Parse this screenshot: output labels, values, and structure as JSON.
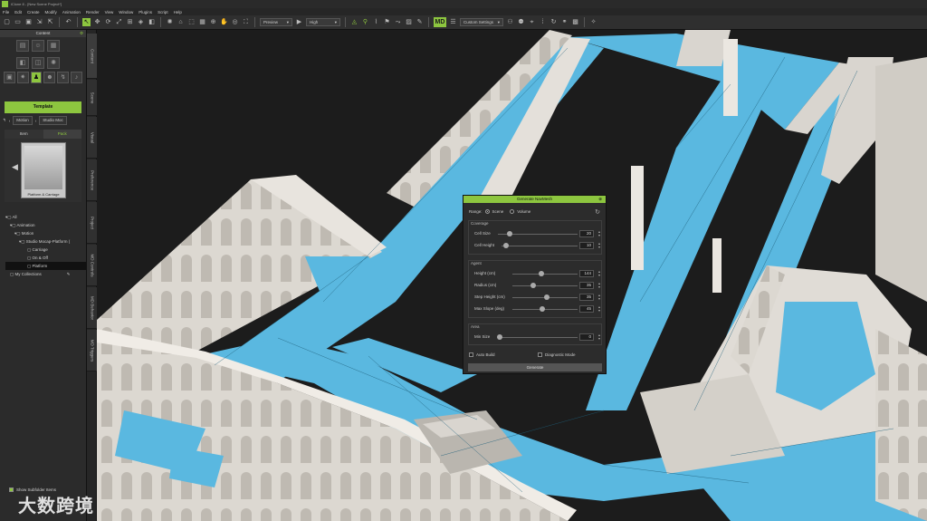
{
  "app": {
    "title": "iClone 8 - [New Scene Project*]"
  },
  "menu": [
    "File",
    "Edit",
    "Create",
    "Modify",
    "Animation",
    "Render",
    "View",
    "Window",
    "Plugins",
    "Script",
    "Help"
  ],
  "toolbar": {
    "preview_mode": "Preview",
    "quality": "High",
    "settings": "Custom Settings"
  },
  "left_panel": {
    "title": "Content",
    "template_label": "Template",
    "breadcrumb": [
      "Motion",
      "Studio Moc"
    ],
    "tabs": [
      {
        "label": "Item"
      },
      {
        "label": "Pack"
      }
    ],
    "thumbnail_caption": "Platform & Carriage",
    "tree": [
      "All",
      "Animation",
      "Motion",
      "Studio Mocap-Platform (",
      "Carriage",
      "On & Off",
      "Platform",
      "My Collections"
    ],
    "show_subfolder": "Show Subfolder Items"
  },
  "vertical_tabs": [
    "Content",
    "Scene",
    "Visual",
    "Preference",
    "Project",
    "MD Controls",
    "MD Behavior",
    "MD Triggers"
  ],
  "dialog": {
    "title": "Generate NavMesh",
    "range_label": "Range:",
    "range_scene": "Scene",
    "range_volume": "Volume",
    "coverage_label": "Coverage",
    "cell_size_label": "Cell Size",
    "cell_size": "20",
    "cell_height_label": "Cell Height",
    "cell_height": "10",
    "agent_label": "Agent",
    "height_label": "Height (cm)",
    "height": "144",
    "radius_label": "Radius (cm)",
    "radius": "35",
    "step_label": "Step Height (cm)",
    "step": "35",
    "slope_label": "Max Slope (deg)",
    "slope": "45",
    "area_label": "Area",
    "min_size_label": "Min Size",
    "min_size": "0",
    "auto_build": "Auto Build",
    "diagnostic": "Diagnostic Mode",
    "generate": "Generate"
  },
  "watermark": "大数跨境",
  "colors": {
    "accent": "#8dc63f",
    "navmesh": "#5ab8e0",
    "wall": "#d9d5cf"
  }
}
